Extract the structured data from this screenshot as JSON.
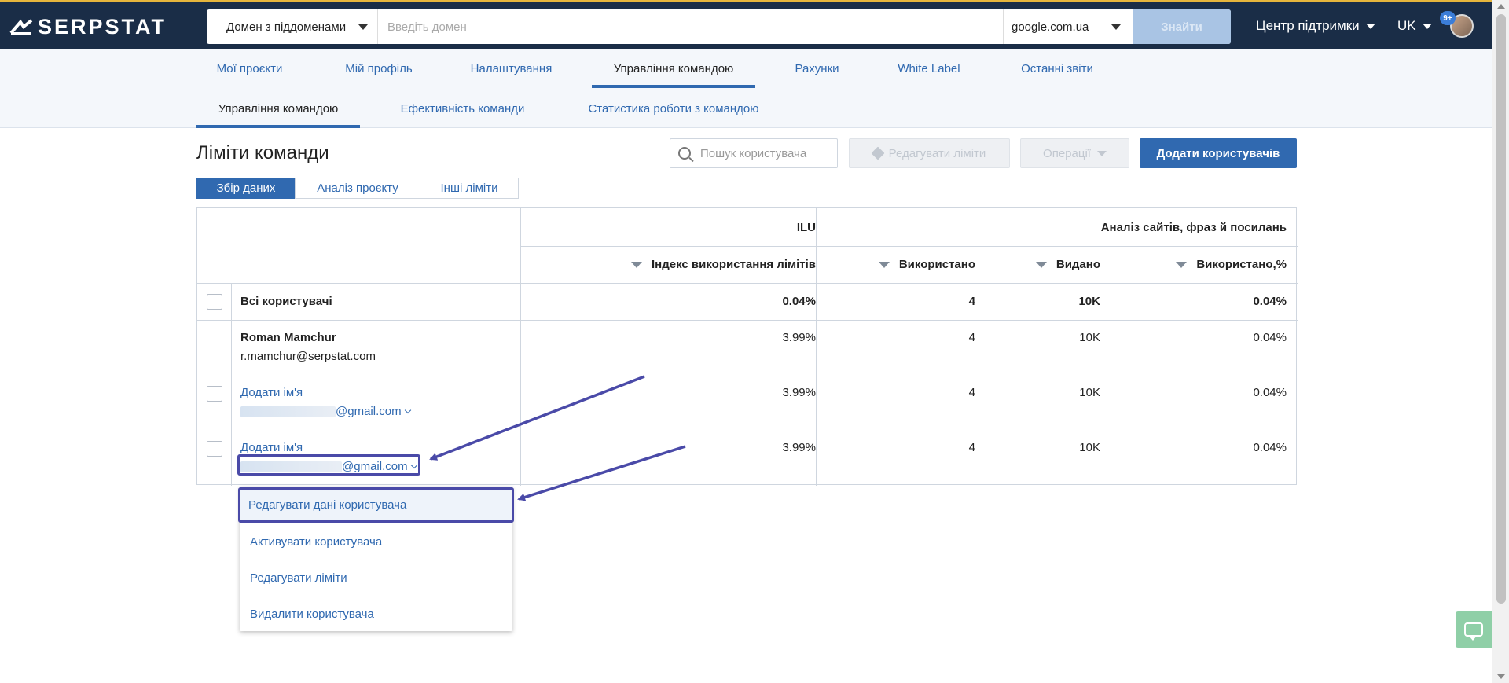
{
  "header": {
    "logo_text": "SERPSTAT",
    "domain_mode": "Домен з піддоменами",
    "domain_placeholder": "Введіть домен",
    "search_engine": "google.com.ua",
    "find_label": "Знайти",
    "support_label": "Центр підтримки",
    "lang_label": "UK",
    "notifications_badge": "9+"
  },
  "nav": {
    "main": [
      {
        "label": "Мої проєкти"
      },
      {
        "label": "Мій профіль"
      },
      {
        "label": "Налаштування"
      },
      {
        "label": "Управління командою"
      },
      {
        "label": "Рахунки"
      },
      {
        "label": "White Label"
      },
      {
        "label": "Останні звіти"
      }
    ],
    "main_active": "Управління командою",
    "sub": [
      {
        "label": "Управління командою"
      },
      {
        "label": "Ефективність команди"
      },
      {
        "label": "Статистика роботи з командою"
      }
    ],
    "sub_active": "Управління командою"
  },
  "page": {
    "title": "Ліміти команди",
    "search_placeholder": "Пошук користувача",
    "edit_limits_label": "Редагувати ліміти",
    "operations_label": "Операції",
    "add_users_label": "Додати користувачів"
  },
  "tabs": [
    {
      "label": "Збір даних",
      "active": true
    },
    {
      "label": "Аналіз проєкту",
      "active": false
    },
    {
      "label": "Інші ліміти",
      "active": false
    }
  ],
  "table": {
    "group_headers": {
      "ilu": "ILU",
      "analysis": "Аналіз сайтів, фраз й посилань"
    },
    "columns": [
      "Індекс використання лімітів",
      "Використано",
      "Видано",
      "Використано,%"
    ],
    "total_row": {
      "label": "Всі користувачі",
      "ilu": "0.04%",
      "used": "4",
      "issued": "10K",
      "used_pct": "0.04%"
    },
    "rows": [
      {
        "name": "Roman Mamchur",
        "email": "r.mamchur@serpstat.com",
        "ilu": "3.99%",
        "used": "4",
        "issued": "10K",
        "used_pct": "0.04%"
      },
      {
        "name": "Додати ім'я",
        "email": "@gmail.com",
        "ilu": "3.99%",
        "used": "4",
        "issued": "10K",
        "used_pct": "0.04%"
      },
      {
        "name": "Додати ім'я",
        "email": "@gmail.com",
        "ilu": "3.99%",
        "used": "4",
        "issued": "10K",
        "used_pct": "0.04%"
      }
    ]
  },
  "user_menu": {
    "items": [
      {
        "label": "Редагувати дані користувача",
        "highlighted": true
      },
      {
        "label": "Активувати користувача"
      },
      {
        "label": "Редагувати ліміти"
      },
      {
        "label": "Видалити користувача"
      }
    ]
  },
  "colors": {
    "header_bg": "#1a2d47",
    "accent": "#3069b0",
    "annotation": "#4a4aa8"
  }
}
